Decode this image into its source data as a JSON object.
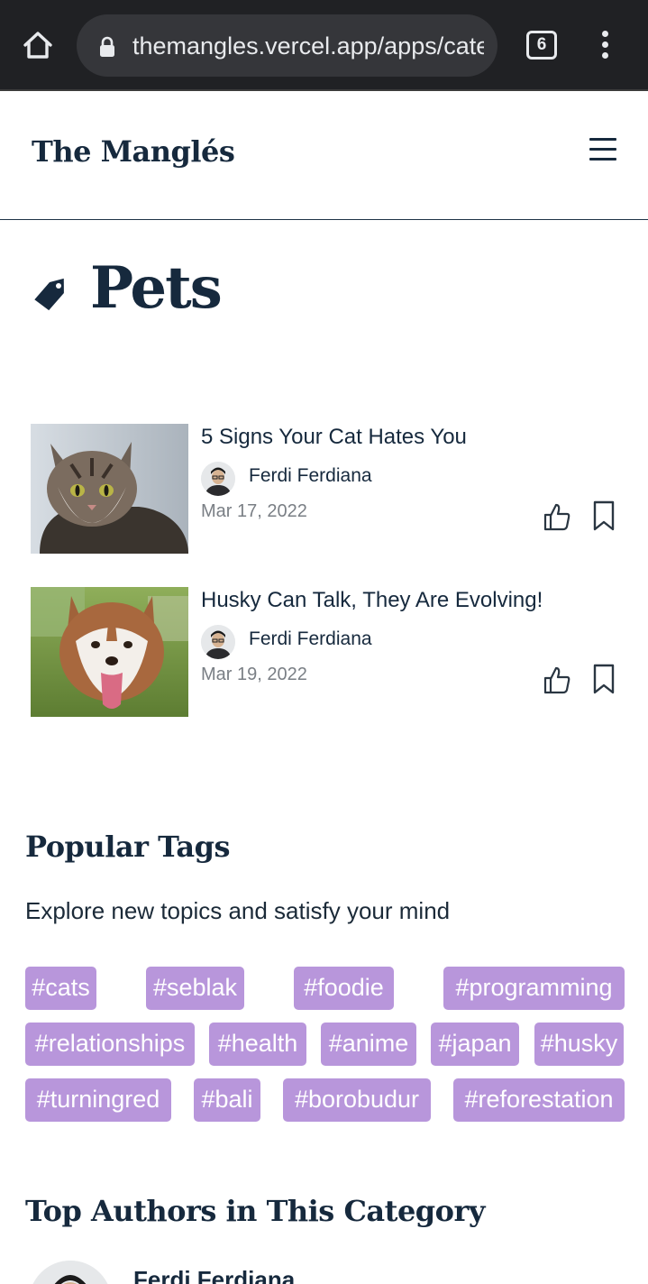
{
  "browser": {
    "url": "themangles.vercel.app/apps/category/pets",
    "tab_count": "6"
  },
  "site": {
    "brand": "The Manglés"
  },
  "category": {
    "title": "Pets"
  },
  "articles": [
    {
      "title": "5 Signs Your Cat Hates You",
      "author": "Ferdi Ferdiana",
      "date": "Mar 17, 2022"
    },
    {
      "title": "Husky Can Talk, They Are Evolving!",
      "author": "Ferdi Ferdiana",
      "date": "Mar 19, 2022"
    }
  ],
  "popular_tags": {
    "heading": "Popular Tags",
    "subtitle": "Explore new topics and satisfy your mind",
    "tags": [
      "#cats",
      "#seblak",
      "#foodie",
      "#programming",
      "#relationships",
      "#health",
      "#anime",
      "#japan",
      "#husky",
      "#turningred",
      "#bali",
      "#borobudur",
      "#reforestation"
    ]
  },
  "top_authors": {
    "heading": "Top Authors in This Category",
    "authors": [
      {
        "name": "Ferdi Ferdiana"
      }
    ]
  },
  "colors": {
    "brand_navy": "#16293d",
    "tag_purple": "#b896db",
    "chrome_dark": "#202124"
  }
}
